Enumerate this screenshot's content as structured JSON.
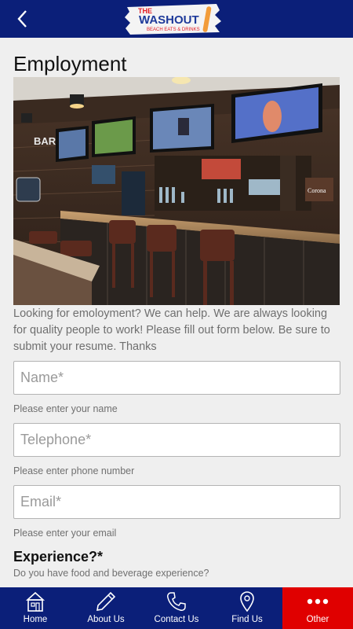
{
  "header": {
    "logo_text": "THE WASHOUT",
    "logo_sub": "BEACH EATS & DRINKS"
  },
  "page": {
    "title": "Employment",
    "intro": "Looking for emoloyment?  We can help.  We are always looking for quality people to work!  Please fill out form below.  Be sure to submit your resume.  Thanks",
    "photo_signs": {
      "bar": "BAR",
      "corona": "Corona"
    }
  },
  "form": {
    "name": {
      "placeholder": "Name*",
      "value": "",
      "hint": "Please enter your name"
    },
    "telephone": {
      "placeholder": "Telephone*",
      "value": "",
      "hint": "Please enter phone number"
    },
    "email": {
      "placeholder": "Email*",
      "value": "",
      "hint": "Please enter your email"
    },
    "experience": {
      "title": "Experience?*",
      "question": "Do you have food and beverage experience?"
    }
  },
  "tabs": [
    {
      "label": "Home",
      "icon": "home-icon"
    },
    {
      "label": "About Us",
      "icon": "pencil-icon"
    },
    {
      "label": "Contact Us",
      "icon": "phone-icon"
    },
    {
      "label": "Find Us",
      "icon": "map-pin-icon"
    },
    {
      "label": "Other",
      "icon": "more-icon"
    }
  ],
  "colors": {
    "navy": "#0b1f79",
    "active_tab": "#e00000"
  }
}
